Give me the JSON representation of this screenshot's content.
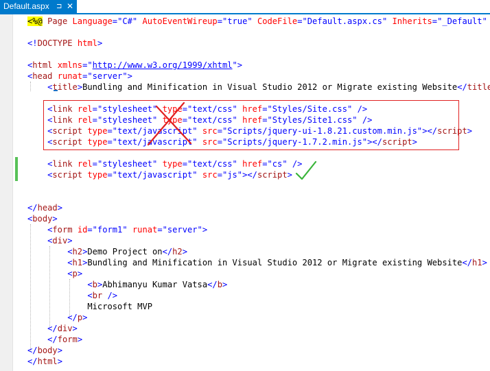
{
  "tab": {
    "title": "Default.aspx",
    "pin_icon": "⊐",
    "close_icon": "✕"
  },
  "lines": [
    {
      "tokens": [
        {
          "c": "hl",
          "s": "<%@"
        },
        {
          "c": "x",
          "s": " "
        },
        {
          "c": "t",
          "s": "Page"
        },
        {
          "c": "x",
          "s": " "
        },
        {
          "c": "a",
          "s": "Language"
        },
        {
          "c": "d",
          "s": "="
        },
        {
          "c": "v",
          "s": "\"C#\""
        },
        {
          "c": "x",
          "s": " "
        },
        {
          "c": "a",
          "s": "AutoEventWireup"
        },
        {
          "c": "d",
          "s": "="
        },
        {
          "c": "v",
          "s": "\"true\""
        },
        {
          "c": "x",
          "s": " "
        },
        {
          "c": "a",
          "s": "CodeFile"
        },
        {
          "c": "d",
          "s": "="
        },
        {
          "c": "v",
          "s": "\"Default.aspx.cs\""
        },
        {
          "c": "x",
          "s": " "
        },
        {
          "c": "a",
          "s": "Inherits"
        },
        {
          "c": "d",
          "s": "="
        },
        {
          "c": "v",
          "s": "\"_Default\""
        },
        {
          "c": "x",
          "s": " "
        },
        {
          "c": "hl",
          "s": "%>"
        }
      ]
    },
    {
      "tokens": []
    },
    {
      "tokens": [
        {
          "c": "d",
          "s": "<!"
        },
        {
          "c": "t",
          "s": "DOCTYPE"
        },
        {
          "c": "x",
          "s": " "
        },
        {
          "c": "a",
          "s": "html"
        },
        {
          "c": "d",
          "s": ">"
        }
      ]
    },
    {
      "tokens": []
    },
    {
      "tokens": [
        {
          "c": "d",
          "s": "<"
        },
        {
          "c": "t",
          "s": "html"
        },
        {
          "c": "x",
          "s": " "
        },
        {
          "c": "a",
          "s": "xmlns"
        },
        {
          "c": "d",
          "s": "="
        },
        {
          "c": "d",
          "s": "\""
        },
        {
          "c": "v u",
          "s": "http://www.w3.org/1999/xhtml"
        },
        {
          "c": "d",
          "s": "\">"
        }
      ]
    },
    {
      "tokens": [
        {
          "c": "d",
          "s": "<"
        },
        {
          "c": "t",
          "s": "head"
        },
        {
          "c": "x",
          "s": " "
        },
        {
          "c": "a",
          "s": "runat"
        },
        {
          "c": "d",
          "s": "="
        },
        {
          "c": "v",
          "s": "\"server\""
        },
        {
          "c": "d",
          "s": ">"
        }
      ]
    },
    {
      "tokens": [
        {
          "c": "x",
          "s": "    "
        },
        {
          "c": "d",
          "s": "<"
        },
        {
          "c": "t",
          "s": "title"
        },
        {
          "c": "d",
          "s": ">"
        },
        {
          "c": "x",
          "s": "Bundling and Minification in Visual Studio 2012 or Migrate existing Website"
        },
        {
          "c": "d",
          "s": "</"
        },
        {
          "c": "t",
          "s": "title"
        },
        {
          "c": "d",
          "s": ">"
        }
      ]
    },
    {
      "tokens": []
    },
    {
      "tokens": [
        {
          "c": "x",
          "s": "    "
        },
        {
          "c": "d",
          "s": "<"
        },
        {
          "c": "t",
          "s": "link"
        },
        {
          "c": "x",
          "s": " "
        },
        {
          "c": "a",
          "s": "rel"
        },
        {
          "c": "d",
          "s": "="
        },
        {
          "c": "v",
          "s": "\"stylesheet\""
        },
        {
          "c": "x",
          "s": " "
        },
        {
          "c": "a",
          "s": "type"
        },
        {
          "c": "d",
          "s": "="
        },
        {
          "c": "v",
          "s": "\"text/css\""
        },
        {
          "c": "x",
          "s": " "
        },
        {
          "c": "a",
          "s": "href"
        },
        {
          "c": "d",
          "s": "="
        },
        {
          "c": "v",
          "s": "\"Styles/Site.css\""
        },
        {
          "c": "x",
          "s": " "
        },
        {
          "c": "d",
          "s": "/>"
        }
      ]
    },
    {
      "tokens": [
        {
          "c": "x",
          "s": "    "
        },
        {
          "c": "d",
          "s": "<"
        },
        {
          "c": "t",
          "s": "link"
        },
        {
          "c": "x",
          "s": " "
        },
        {
          "c": "a",
          "s": "rel"
        },
        {
          "c": "d",
          "s": "="
        },
        {
          "c": "v",
          "s": "\"stylesheet\""
        },
        {
          "c": "x",
          "s": " "
        },
        {
          "c": "a",
          "s": "type"
        },
        {
          "c": "d",
          "s": "="
        },
        {
          "c": "v",
          "s": "\"text/css\""
        },
        {
          "c": "x",
          "s": " "
        },
        {
          "c": "a",
          "s": "href"
        },
        {
          "c": "d",
          "s": "="
        },
        {
          "c": "v",
          "s": "\"Styles/Site1.css\""
        },
        {
          "c": "x",
          "s": " "
        },
        {
          "c": "d",
          "s": "/>"
        }
      ]
    },
    {
      "tokens": [
        {
          "c": "x",
          "s": "    "
        },
        {
          "c": "d",
          "s": "<"
        },
        {
          "c": "t",
          "s": "script"
        },
        {
          "c": "x",
          "s": " "
        },
        {
          "c": "a",
          "s": "type"
        },
        {
          "c": "d",
          "s": "="
        },
        {
          "c": "v",
          "s": "\"text/javascript\""
        },
        {
          "c": "x",
          "s": " "
        },
        {
          "c": "a",
          "s": "src"
        },
        {
          "c": "d",
          "s": "="
        },
        {
          "c": "v",
          "s": "\"Scripts/jquery-ui-1.8.21.custom.min.js\""
        },
        {
          "c": "d",
          "s": "></"
        },
        {
          "c": "t",
          "s": "script"
        },
        {
          "c": "d",
          "s": ">"
        }
      ]
    },
    {
      "tokens": [
        {
          "c": "x",
          "s": "    "
        },
        {
          "c": "d",
          "s": "<"
        },
        {
          "c": "t",
          "s": "script"
        },
        {
          "c": "x",
          "s": " "
        },
        {
          "c": "a",
          "s": "type"
        },
        {
          "c": "d",
          "s": "="
        },
        {
          "c": "v",
          "s": "\"text/javascript\""
        },
        {
          "c": "x",
          "s": " "
        },
        {
          "c": "a",
          "s": "src"
        },
        {
          "c": "d",
          "s": "="
        },
        {
          "c": "v",
          "s": "\"Scripts/jquery-1.7.2.min.js\""
        },
        {
          "c": "d",
          "s": "></"
        },
        {
          "c": "t",
          "s": "script"
        },
        {
          "c": "d",
          "s": ">"
        }
      ]
    },
    {
      "tokens": []
    },
    {
      "tokens": [
        {
          "c": "x",
          "s": "    "
        },
        {
          "c": "d",
          "s": "<"
        },
        {
          "c": "t",
          "s": "link"
        },
        {
          "c": "x",
          "s": " "
        },
        {
          "c": "a",
          "s": "rel"
        },
        {
          "c": "d",
          "s": "="
        },
        {
          "c": "v",
          "s": "\"stylesheet\""
        },
        {
          "c": "x",
          "s": " "
        },
        {
          "c": "a",
          "s": "type"
        },
        {
          "c": "d",
          "s": "="
        },
        {
          "c": "v",
          "s": "\"text/css\""
        },
        {
          "c": "x",
          "s": " "
        },
        {
          "c": "a",
          "s": "href"
        },
        {
          "c": "d",
          "s": "="
        },
        {
          "c": "v",
          "s": "\"cs\""
        },
        {
          "c": "x",
          "s": " "
        },
        {
          "c": "d",
          "s": "/>"
        }
      ]
    },
    {
      "tokens": [
        {
          "c": "x",
          "s": "    "
        },
        {
          "c": "d",
          "s": "<"
        },
        {
          "c": "t",
          "s": "script"
        },
        {
          "c": "x",
          "s": " "
        },
        {
          "c": "a",
          "s": "type"
        },
        {
          "c": "d",
          "s": "="
        },
        {
          "c": "v",
          "s": "\"text/javascript\""
        },
        {
          "c": "x",
          "s": " "
        },
        {
          "c": "a",
          "s": "src"
        },
        {
          "c": "d",
          "s": "="
        },
        {
          "c": "v",
          "s": "\"js\""
        },
        {
          "c": "d",
          "s": "></"
        },
        {
          "c": "t",
          "s": "script"
        },
        {
          "c": "d",
          "s": ">"
        }
      ]
    },
    {
      "tokens": []
    },
    {
      "tokens": []
    },
    {
      "tokens": [
        {
          "c": "d",
          "s": "</"
        },
        {
          "c": "t",
          "s": "head"
        },
        {
          "c": "d",
          "s": ">"
        }
      ]
    },
    {
      "tokens": [
        {
          "c": "d",
          "s": "<"
        },
        {
          "c": "t",
          "s": "body"
        },
        {
          "c": "d",
          "s": ">"
        }
      ]
    },
    {
      "tokens": [
        {
          "c": "x",
          "s": "    "
        },
        {
          "c": "d",
          "s": "<"
        },
        {
          "c": "t",
          "s": "form"
        },
        {
          "c": "x",
          "s": " "
        },
        {
          "c": "a",
          "s": "id"
        },
        {
          "c": "d",
          "s": "="
        },
        {
          "c": "v",
          "s": "\"form1\""
        },
        {
          "c": "x",
          "s": " "
        },
        {
          "c": "a",
          "s": "runat"
        },
        {
          "c": "d",
          "s": "="
        },
        {
          "c": "v",
          "s": "\"server\""
        },
        {
          "c": "d",
          "s": ">"
        }
      ]
    },
    {
      "tokens": [
        {
          "c": "x",
          "s": "    "
        },
        {
          "c": "d",
          "s": "<"
        },
        {
          "c": "t",
          "s": "div"
        },
        {
          "c": "d",
          "s": ">"
        }
      ]
    },
    {
      "tokens": [
        {
          "c": "x",
          "s": "        "
        },
        {
          "c": "d",
          "s": "<"
        },
        {
          "c": "t",
          "s": "h2"
        },
        {
          "c": "d",
          "s": ">"
        },
        {
          "c": "x",
          "s": "Demo Project on"
        },
        {
          "c": "d",
          "s": "</"
        },
        {
          "c": "t",
          "s": "h2"
        },
        {
          "c": "d",
          "s": ">"
        }
      ]
    },
    {
      "tokens": [
        {
          "c": "x",
          "s": "        "
        },
        {
          "c": "d",
          "s": "<"
        },
        {
          "c": "t",
          "s": "h1"
        },
        {
          "c": "d",
          "s": ">"
        },
        {
          "c": "x",
          "s": "Bundling and Minification in Visual Studio 2012 or Migrate existing Website"
        },
        {
          "c": "d",
          "s": "</"
        },
        {
          "c": "t",
          "s": "h1"
        },
        {
          "c": "d",
          "s": ">"
        }
      ]
    },
    {
      "tokens": [
        {
          "c": "x",
          "s": "        "
        },
        {
          "c": "d",
          "s": "<"
        },
        {
          "c": "t",
          "s": "p"
        },
        {
          "c": "d",
          "s": ">"
        }
      ]
    },
    {
      "tokens": [
        {
          "c": "x",
          "s": "            "
        },
        {
          "c": "d",
          "s": "<"
        },
        {
          "c": "t",
          "s": "b"
        },
        {
          "c": "d",
          "s": ">"
        },
        {
          "c": "x",
          "s": "Abhimanyu Kumar Vatsa"
        },
        {
          "c": "d",
          "s": "</"
        },
        {
          "c": "t",
          "s": "b"
        },
        {
          "c": "d",
          "s": ">"
        }
      ]
    },
    {
      "tokens": [
        {
          "c": "x",
          "s": "            "
        },
        {
          "c": "d",
          "s": "<"
        },
        {
          "c": "t",
          "s": "br"
        },
        {
          "c": "x",
          "s": " "
        },
        {
          "c": "d",
          "s": "/>"
        }
      ]
    },
    {
      "tokens": [
        {
          "c": "x",
          "s": "            "
        },
        {
          "c": "x",
          "s": "Microsoft MVP"
        }
      ]
    },
    {
      "tokens": [
        {
          "c": "x",
          "s": "        "
        },
        {
          "c": "d",
          "s": "</"
        },
        {
          "c": "t",
          "s": "p"
        },
        {
          "c": "d",
          "s": ">"
        }
      ]
    },
    {
      "tokens": [
        {
          "c": "x",
          "s": "    "
        },
        {
          "c": "d",
          "s": "</"
        },
        {
          "c": "t",
          "s": "div"
        },
        {
          "c": "d",
          "s": ">"
        }
      ]
    },
    {
      "tokens": [
        {
          "c": "x",
          "s": "    "
        },
        {
          "c": "d",
          "s": "</"
        },
        {
          "c": "t",
          "s": "form"
        },
        {
          "c": "d",
          "s": ">"
        }
      ]
    },
    {
      "tokens": [
        {
          "c": "d",
          "s": "</"
        },
        {
          "c": "t",
          "s": "body"
        },
        {
          "c": "d",
          "s": ">"
        }
      ]
    },
    {
      "tokens": [
        {
          "c": "d",
          "s": "</"
        },
        {
          "c": "t",
          "s": "html"
        },
        {
          "c": "d",
          "s": ">"
        }
      ]
    }
  ],
  "annotations": {
    "cross_icon": "red-x-mark",
    "check_icon": "green-check-mark",
    "cross_color": "#e02020",
    "check_color": "#3ab53a"
  },
  "colors": {
    "accent": "#007acc",
    "change_bar": "#58c158",
    "highlight": "#ffff00"
  }
}
